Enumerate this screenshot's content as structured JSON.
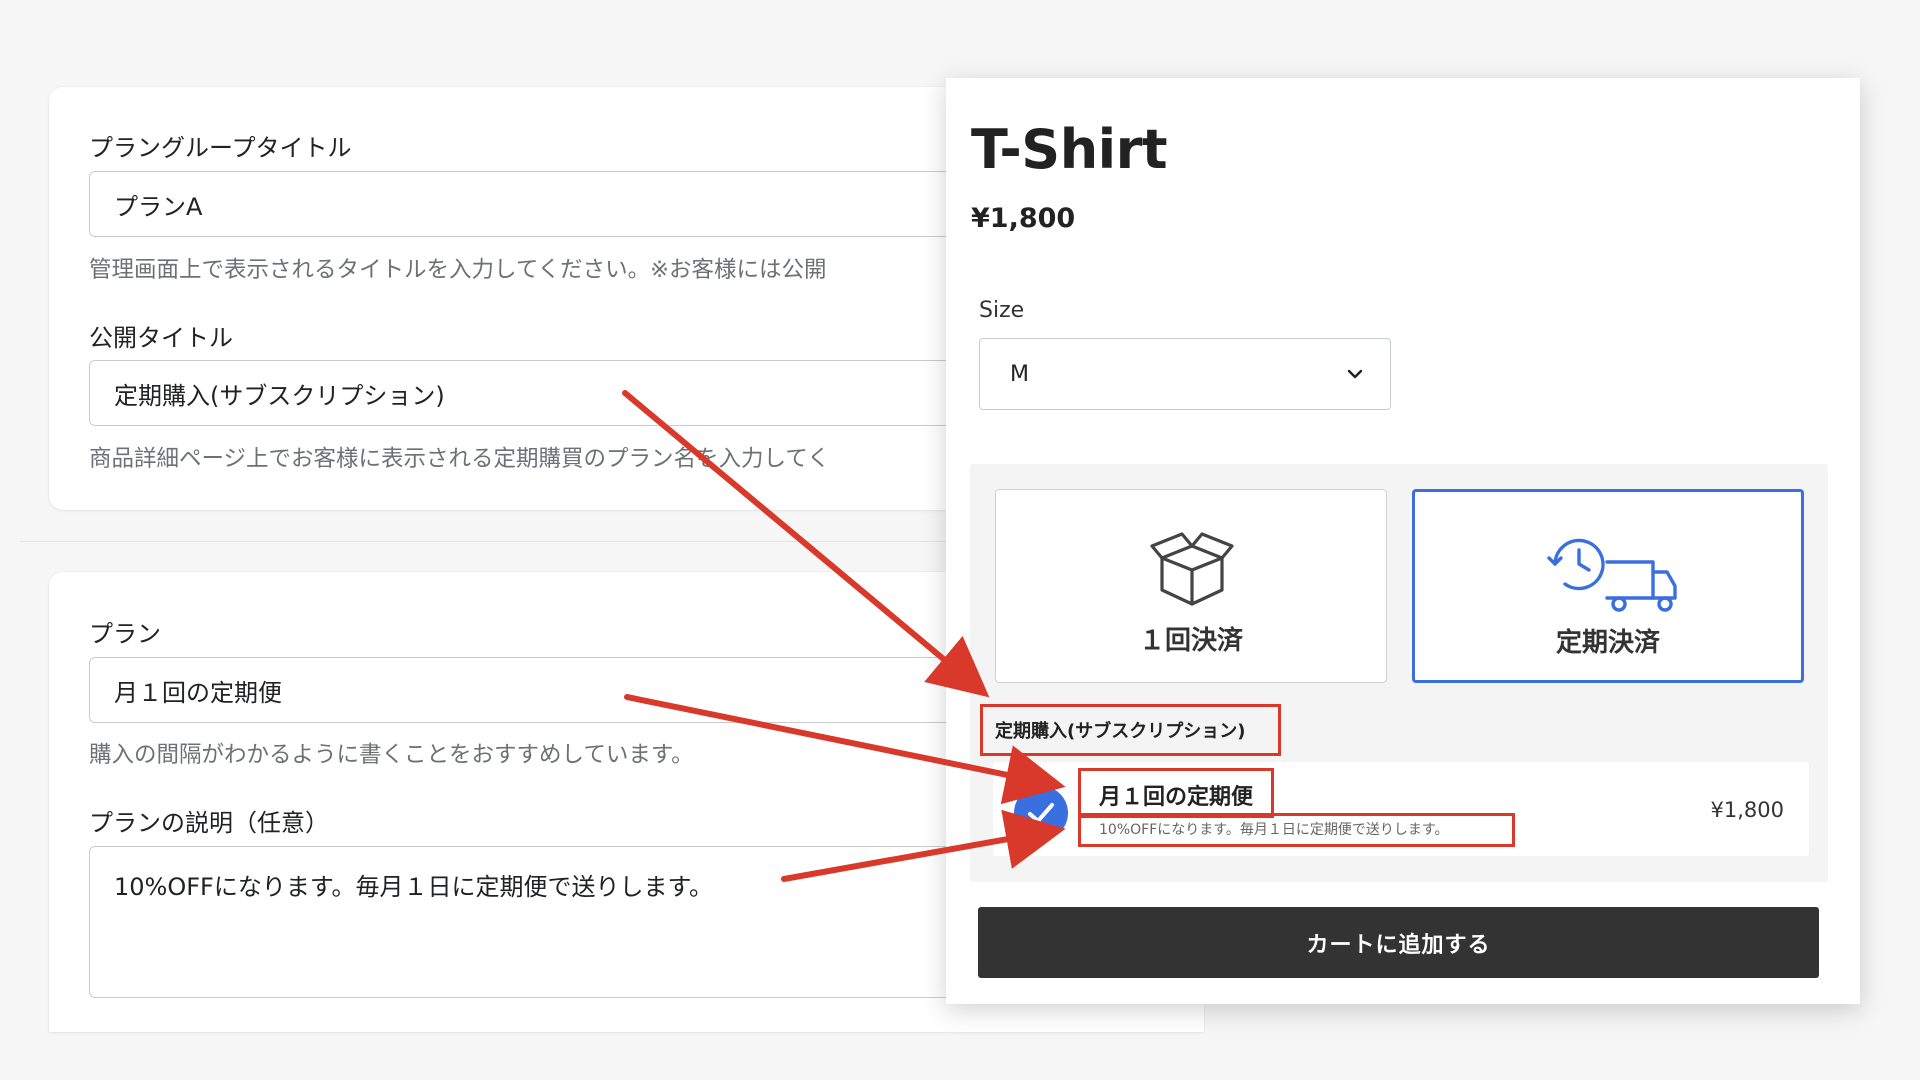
{
  "admin": {
    "group_title_label": "プラングループタイトル",
    "group_title_value": "プランA",
    "group_title_help": "管理画面上で表示されるタイトルを入力してください。※お客様には公開",
    "public_title_label": "公開タイトル",
    "public_title_value": "定期購入(サブスクリプション)",
    "public_title_help": "商品詳細ページ上でお客様に表示される定期購買のプラン名を入力してく",
    "plan_label": "プラン",
    "plan_value": "月１回の定期便",
    "plan_help": "購入の間隔がわかるように書くことをおすすめしています。",
    "plan_desc_label": "プランの説明（任意）",
    "plan_desc_value": "10%OFFになります。毎月１日に定期便で送りします。"
  },
  "product": {
    "title": "T-Shirt",
    "price": "¥1,800",
    "size_label": "Size",
    "size_value": "M",
    "options": [
      {
        "label": "１回決済",
        "icon": "box-icon"
      },
      {
        "label": "定期決済",
        "icon": "clock-truck-icon"
      }
    ],
    "group_label": "定期購入(サブスクリプション)",
    "plan_name": "月１回の定期便",
    "plan_desc": "10%OFFになります。毎月１日に定期便で送りします。",
    "plan_price": "¥1,800",
    "cart_button": "カートに追加する"
  },
  "colors": {
    "accent": "#3a6fe0",
    "annotation": "#d9392b",
    "button": "#333333"
  }
}
